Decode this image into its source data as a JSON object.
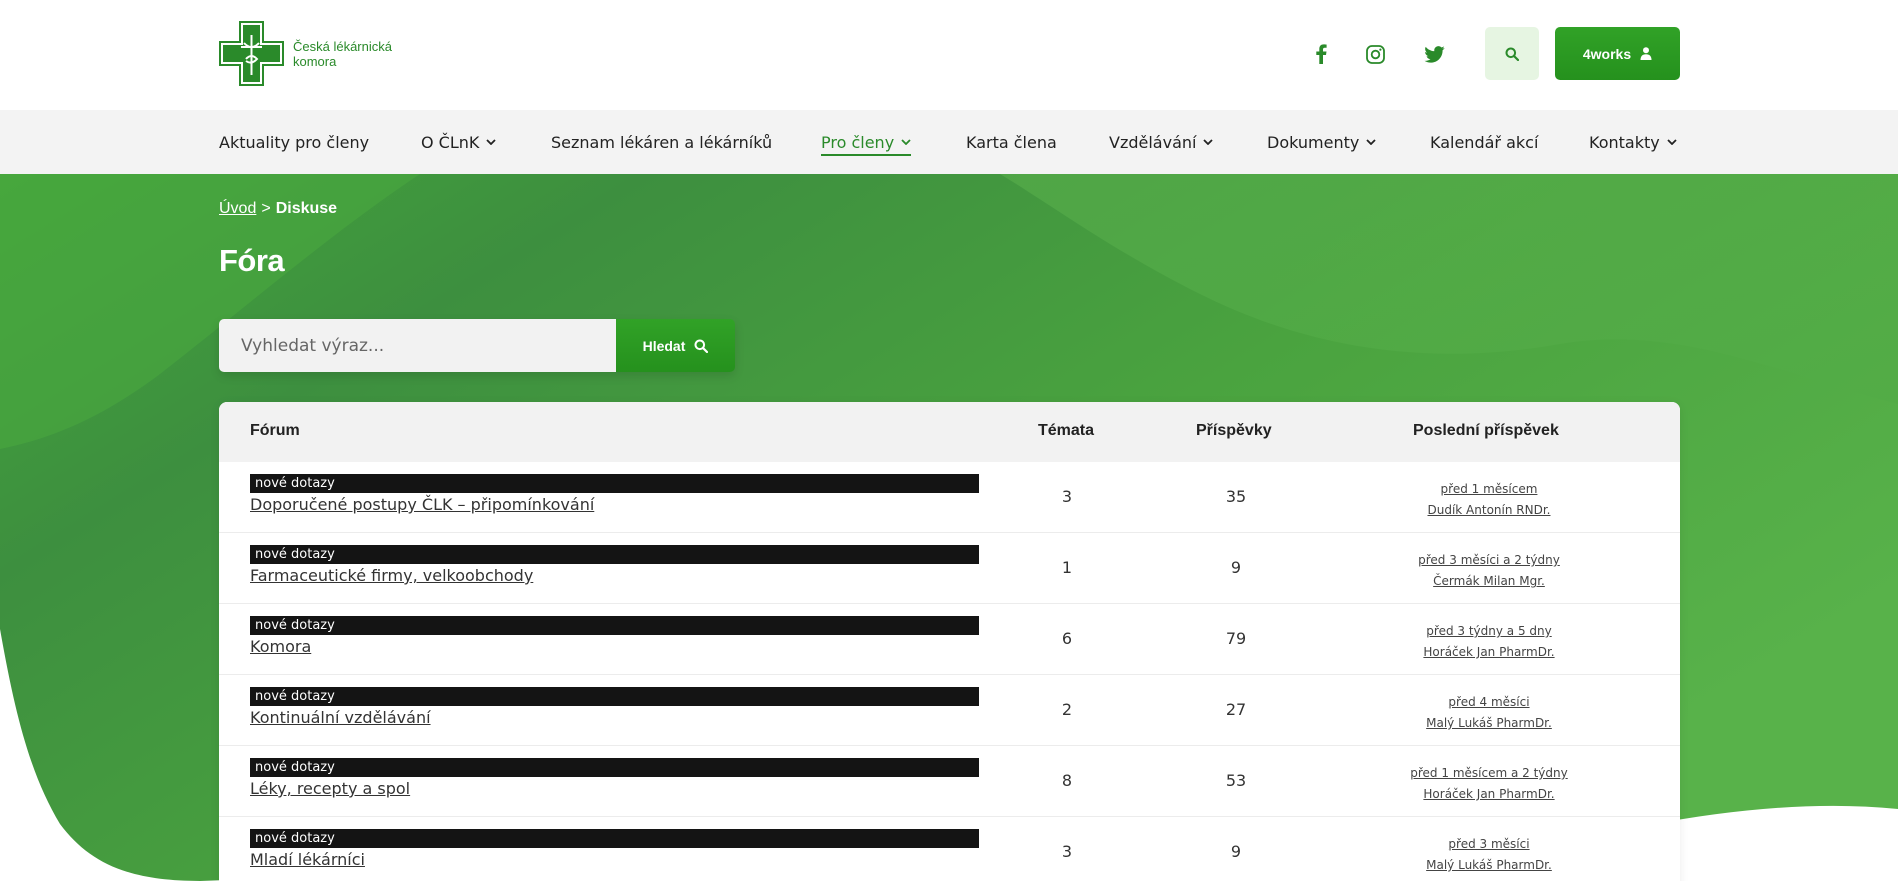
{
  "header": {
    "logo_line1": "Česká lékárnická",
    "logo_line2": "komora",
    "social_icons": [
      "facebook-icon",
      "instagram-icon",
      "twitter-icon"
    ],
    "account_button": "4works",
    "brand_color": "#2a8a2a"
  },
  "nav": {
    "items": [
      {
        "label": "Aktuality pro členy",
        "dropdown": false
      },
      {
        "label": "O ČLnK",
        "dropdown": true
      },
      {
        "label": "Seznam lékáren a lékárníků",
        "dropdown": false
      },
      {
        "label": "Pro členy",
        "dropdown": true,
        "active": true
      },
      {
        "label": "Karta člena",
        "dropdown": false
      },
      {
        "label": "Vzdělávání",
        "dropdown": true
      },
      {
        "label": "Dokumenty",
        "dropdown": true
      },
      {
        "label": "Kalendář akcí",
        "dropdown": false
      },
      {
        "label": "Kontakty",
        "dropdown": true
      }
    ]
  },
  "breadcrumb": {
    "home": "Úvod",
    "separator": ">",
    "current": "Diskuse"
  },
  "page": {
    "title": "Fóra"
  },
  "search": {
    "placeholder": "Vyhledat výraz...",
    "button": "Hledat"
  },
  "table": {
    "headers": {
      "forum": "Fórum",
      "topics": "Témata",
      "posts": "Příspěvky",
      "last_post": "Poslední příspěvek"
    },
    "rows": [
      {
        "badge": "nové dotazy",
        "name": "Doporučené postupy ČLK – připomínkování",
        "topics": "3",
        "posts": "35",
        "last_time": "před 1 měsícem",
        "last_author": "Dudík Antonín RNDr."
      },
      {
        "badge": "nové dotazy",
        "name": "Farmaceutické firmy, velkoobchody",
        "topics": "1",
        "posts": "9",
        "last_time": "před 3 měsíci a 2 týdny",
        "last_author": "Čermák Milan Mgr."
      },
      {
        "badge": "nové dotazy",
        "name": "Komora",
        "topics": "6",
        "posts": "79",
        "last_time": "před 3 týdny a 5 dny",
        "last_author": "Horáček Jan PharmDr."
      },
      {
        "badge": "nové dotazy",
        "name": "Kontinuální vzdělávání",
        "topics": "2",
        "posts": "27",
        "last_time": "před 4 měsíci",
        "last_author": "Malý Lukáš PharmDr."
      },
      {
        "badge": "nové dotazy",
        "name": "Léky, recepty a spol",
        "topics": "8",
        "posts": "53",
        "last_time": "před 1 měsícem a 2 týdny",
        "last_author": "Horáček Jan PharmDr."
      },
      {
        "badge": "nové dotazy",
        "name": "Mladí lékárníci",
        "topics": "3",
        "posts": "9",
        "last_time": "před 3 měsíci",
        "last_author": "Malý Lukáš PharmDr."
      }
    ]
  }
}
